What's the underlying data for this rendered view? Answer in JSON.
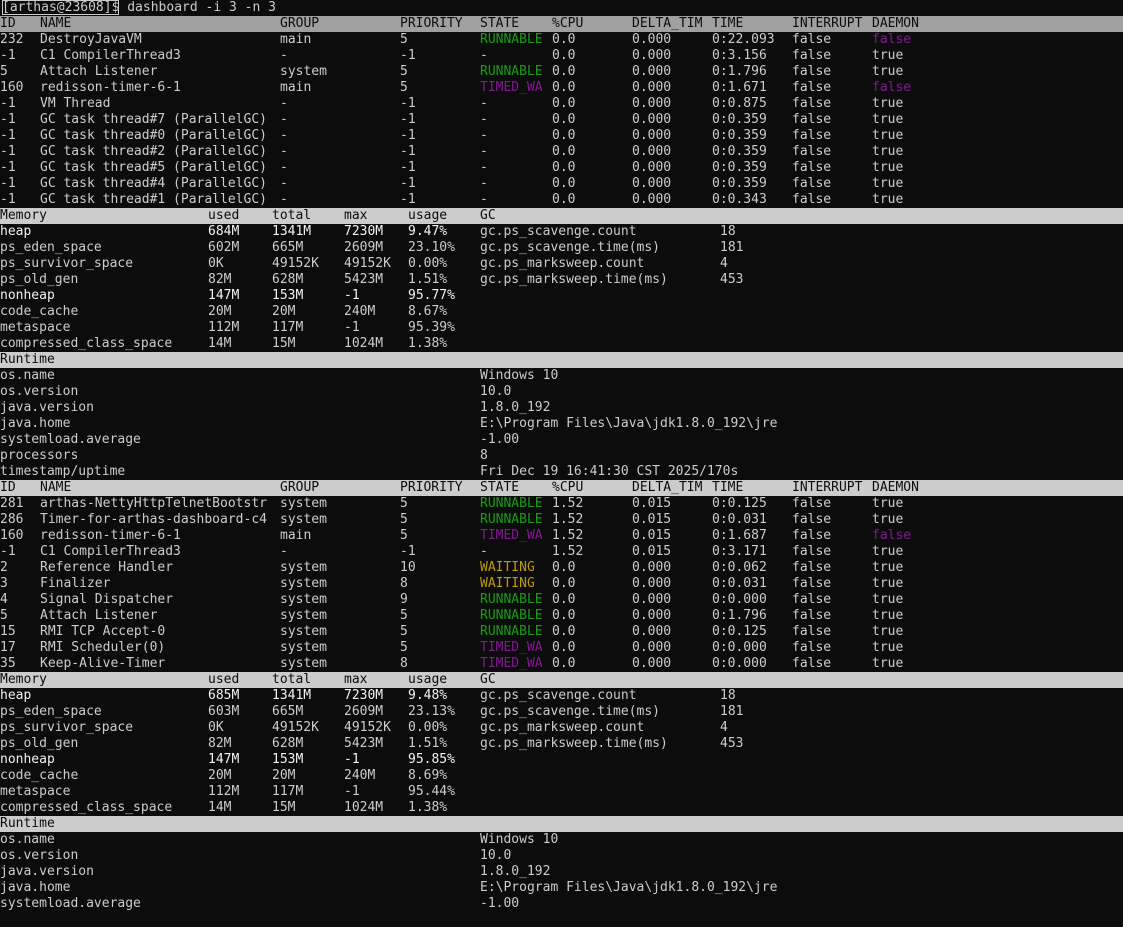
{
  "prompt": {
    "user": "[arthas@23608]$",
    "command": " dashboard -i 3 -n 3"
  },
  "colors": {
    "background": "#0c0c0c",
    "text": "#cccccc",
    "header_bg": "#cccccc",
    "runnable": "#13a10e",
    "waiting": "#c19c00",
    "timed_waiting": "#881798"
  },
  "thread_headers": [
    "ID",
    "NAME",
    "GROUP",
    "PRIORITY",
    "STATE",
    "%CPU",
    "DELTA_TIM",
    "TIME",
    "INTERRUPT",
    "DAEMON"
  ],
  "memory_headers": [
    "Memory",
    "used",
    "total",
    "max",
    "usage",
    "GC"
  ],
  "runtime_title": "Runtime",
  "blocks": [
    {
      "threads": [
        [
          "232",
          "DestroyJavaVM",
          "main",
          "5",
          "RUNNABLE",
          "0.0",
          "0.000",
          "0:22.093",
          "false",
          "false"
        ],
        [
          "-1",
          "C1 CompilerThread3",
          "-",
          "-1",
          "-",
          "0.0",
          "0.000",
          "0:3.156",
          "false",
          "true"
        ],
        [
          "5",
          "Attach Listener",
          "system",
          "5",
          "RUNNABLE",
          "0.0",
          "0.000",
          "0:1.796",
          "false",
          "true"
        ],
        [
          "160",
          "redisson-timer-6-1",
          "main",
          "5",
          "TIMED_WA",
          "0.0",
          "0.000",
          "0:1.671",
          "false",
          "false"
        ],
        [
          "-1",
          "VM Thread",
          "-",
          "-1",
          "-",
          "0.0",
          "0.000",
          "0:0.875",
          "false",
          "true"
        ],
        [
          "-1",
          "GC task thread#7 (ParallelGC)",
          "-",
          "-1",
          "-",
          "0.0",
          "0.000",
          "0:0.359",
          "false",
          "true"
        ],
        [
          "-1",
          "GC task thread#0 (ParallelGC)",
          "-",
          "-1",
          "-",
          "0.0",
          "0.000",
          "0:0.359",
          "false",
          "true"
        ],
        [
          "-1",
          "GC task thread#2 (ParallelGC)",
          "-",
          "-1",
          "-",
          "0.0",
          "0.000",
          "0:0.359",
          "false",
          "true"
        ],
        [
          "-1",
          "GC task thread#5 (ParallelGC)",
          "-",
          "-1",
          "-",
          "0.0",
          "0.000",
          "0:0.359",
          "false",
          "true"
        ],
        [
          "-1",
          "GC task thread#4 (ParallelGC)",
          "-",
          "-1",
          "-",
          "0.0",
          "0.000",
          "0:0.359",
          "false",
          "true"
        ],
        [
          "-1",
          "GC task thread#1 (ParallelGC)",
          "-",
          "-1",
          "-",
          "0.0",
          "0.000",
          "0:0.343",
          "false",
          "true"
        ]
      ],
      "memory": [
        [
          "heap",
          "684M",
          "1341M",
          "7230M",
          "9.47%",
          "gc.ps_scavenge.count",
          "18"
        ],
        [
          "ps_eden_space",
          "602M",
          "665M",
          "2609M",
          "23.10%",
          "gc.ps_scavenge.time(ms)",
          "181"
        ],
        [
          "ps_survivor_space",
          "0K",
          "49152K",
          "49152K",
          "0.00%",
          "gc.ps_marksweep.count",
          "4"
        ],
        [
          "ps_old_gen",
          "82M",
          "628M",
          "5423M",
          "1.51%",
          "gc.ps_marksweep.time(ms)",
          "453"
        ],
        [
          "nonheap",
          "147M",
          "153M",
          "-1",
          "95.77%",
          "",
          ""
        ],
        [
          "code_cache",
          "20M",
          "20M",
          "240M",
          "8.67%",
          "",
          ""
        ],
        [
          "metaspace",
          "112M",
          "117M",
          "-1",
          "95.39%",
          "",
          ""
        ],
        [
          "compressed_class_space",
          "14M",
          "15M",
          "1024M",
          "1.38%",
          "",
          ""
        ]
      ],
      "runtime": [
        [
          "os.name",
          "Windows 10"
        ],
        [
          "os.version",
          "10.0"
        ],
        [
          "java.version",
          "1.8.0_192"
        ],
        [
          "java.home",
          "E:\\Program Files\\Java\\jdk1.8.0_192\\jre"
        ],
        [
          "systemload.average",
          "-1.00"
        ],
        [
          "processors",
          "8"
        ],
        [
          "timestamp/uptime",
          "Fri Dec 19 16:41:30 CST 2025/170s"
        ]
      ]
    },
    {
      "threads": [
        [
          "281",
          "arthas-NettyHttpTelnetBootstr",
          "system",
          "5",
          "RUNNABLE",
          "1.52",
          "0.015",
          "0:0.125",
          "false",
          "true"
        ],
        [
          "286",
          "Timer-for-arthas-dashboard-c4",
          "system",
          "5",
          "RUNNABLE",
          "1.52",
          "0.015",
          "0:0.031",
          "false",
          "true"
        ],
        [
          "160",
          "redisson-timer-6-1",
          "main",
          "5",
          "TIMED_WA",
          "1.52",
          "0.015",
          "0:1.687",
          "false",
          "false"
        ],
        [
          "-1",
          "C1 CompilerThread3",
          "-",
          "-1",
          "-",
          "1.52",
          "0.015",
          "0:3.171",
          "false",
          "true"
        ],
        [
          "2",
          "Reference Handler",
          "system",
          "10",
          "WAITING",
          "0.0",
          "0.000",
          "0:0.062",
          "false",
          "true"
        ],
        [
          "3",
          "Finalizer",
          "system",
          "8",
          "WAITING",
          "0.0",
          "0.000",
          "0:0.031",
          "false",
          "true"
        ],
        [
          "4",
          "Signal Dispatcher",
          "system",
          "9",
          "RUNNABLE",
          "0.0",
          "0.000",
          "0:0.000",
          "false",
          "true"
        ],
        [
          "5",
          "Attach Listener",
          "system",
          "5",
          "RUNNABLE",
          "0.0",
          "0.000",
          "0:1.796",
          "false",
          "true"
        ],
        [
          "15",
          "RMI TCP Accept-0",
          "system",
          "5",
          "RUNNABLE",
          "0.0",
          "0.000",
          "0:0.125",
          "false",
          "true"
        ],
        [
          "17",
          "RMI Scheduler(0)",
          "system",
          "5",
          "TIMED_WA",
          "0.0",
          "0.000",
          "0:0.000",
          "false",
          "true"
        ],
        [
          "35",
          "Keep-Alive-Timer",
          "system",
          "8",
          "TIMED_WA",
          "0.0",
          "0.000",
          "0:0.000",
          "false",
          "true"
        ]
      ],
      "memory": [
        [
          "heap",
          "685M",
          "1341M",
          "7230M",
          "9.48%",
          "gc.ps_scavenge.count",
          "18"
        ],
        [
          "ps_eden_space",
          "603M",
          "665M",
          "2609M",
          "23.13%",
          "gc.ps_scavenge.time(ms)",
          "181"
        ],
        [
          "ps_survivor_space",
          "0K",
          "49152K",
          "49152K",
          "0.00%",
          "gc.ps_marksweep.count",
          "4"
        ],
        [
          "ps_old_gen",
          "82M",
          "628M",
          "5423M",
          "1.51%",
          "gc.ps_marksweep.time(ms)",
          "453"
        ],
        [
          "nonheap",
          "147M",
          "153M",
          "-1",
          "95.85%",
          "",
          ""
        ],
        [
          "code_cache",
          "20M",
          "20M",
          "240M",
          "8.69%",
          "",
          ""
        ],
        [
          "metaspace",
          "112M",
          "117M",
          "-1",
          "95.44%",
          "",
          ""
        ],
        [
          "compressed_class_space",
          "14M",
          "15M",
          "1024M",
          "1.38%",
          "",
          ""
        ]
      ],
      "runtime": [
        [
          "os.name",
          "Windows 10"
        ],
        [
          "os.version",
          "10.0"
        ],
        [
          "java.version",
          "1.8.0_192"
        ],
        [
          "java.home",
          "E:\\Program Files\\Java\\jdk1.8.0_192\\jre"
        ],
        [
          "systemload.average",
          "-1.00"
        ]
      ]
    }
  ]
}
